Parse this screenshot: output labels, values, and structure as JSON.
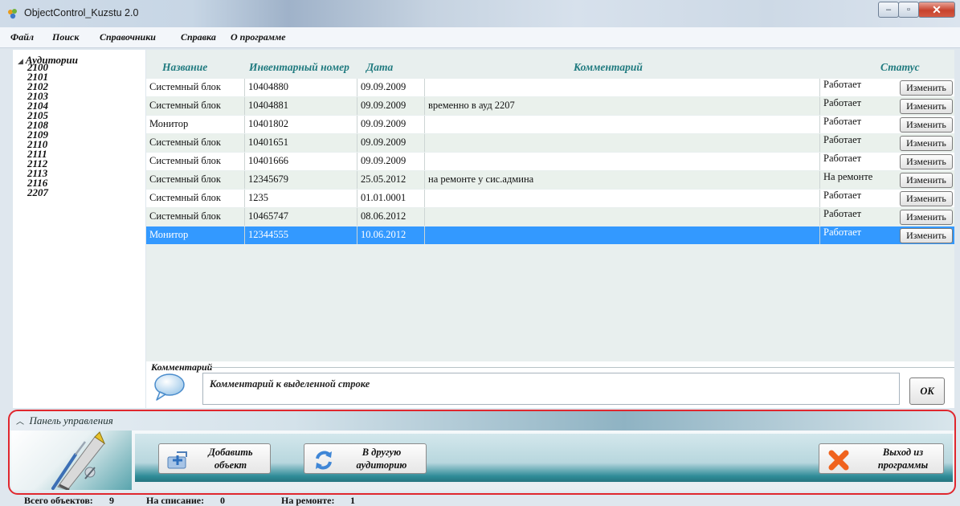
{
  "window": {
    "title": "ObjectControl_Kuzstu 2.0",
    "controls": {
      "minimize": "‒",
      "maximize": "▫",
      "close": "✕"
    }
  },
  "menu": [
    "Файл",
    "Поиск",
    "Справочники",
    "Справка",
    "О программе"
  ],
  "tree": {
    "root": "Аудитории",
    "nodes": [
      "2100",
      "2101",
      "2102",
      "2103",
      "2104",
      "2105",
      "2108",
      "2109",
      "2110",
      "2111",
      "2112",
      "2113",
      "2116",
      "2207"
    ]
  },
  "grid": {
    "columns": [
      "Название",
      "Инвентарный номер",
      "Дата",
      "Комментарий",
      "Статус"
    ],
    "change_label": "Изменить",
    "rows": [
      {
        "name": "Системный блок",
        "inv": "10404880",
        "date": "09.09.2009",
        "comment": "",
        "status": "Работает"
      },
      {
        "name": "Системный блок",
        "inv": "10404881",
        "date": "09.09.2009",
        "comment": "временно в ауд 2207",
        "status": "Работает"
      },
      {
        "name": "Монитор",
        "inv": "10401802",
        "date": "09.09.2009",
        "comment": "",
        "status": "Работает"
      },
      {
        "name": "Системный блок",
        "inv": "10401651",
        "date": "09.09.2009",
        "comment": "",
        "status": "Работает"
      },
      {
        "name": "Системный блок",
        "inv": "10401666",
        "date": "09.09.2009",
        "comment": "",
        "status": "Работает"
      },
      {
        "name": "Системный блок",
        "inv": "12345679",
        "date": "25.05.2012",
        "comment": "на ремонте у сис.админа",
        "status": "На ремонте"
      },
      {
        "name": "Системный блок",
        "inv": "1235",
        "date": "01.01.0001",
        "comment": "",
        "status": "Работает"
      },
      {
        "name": "Системный блок",
        "inv": "10465747",
        "date": "08.06.2012",
        "comment": "",
        "status": "Работает"
      },
      {
        "name": "Монитор",
        "inv": "12344555",
        "date": "10.06.2012",
        "comment": "",
        "status": "Работает",
        "selected": true
      }
    ]
  },
  "comment": {
    "label": "Комментарий",
    "text": "Комментарий к выделенной строке",
    "ok": "OK"
  },
  "panel": {
    "title": "Панель управления",
    "add_line1": "Добавить",
    "add_line2": "объект",
    "move_line1": "В другую",
    "move_line2": "аудиторию",
    "exit_line1": "Выход из",
    "exit_line2": "программы"
  },
  "status": {
    "total_label": "Всего объектов:",
    "total_value": "9",
    "writeoff_label": "На списание:",
    "writeoff_value": "0",
    "repair_label": "На ремонте:",
    "repair_value": "1"
  },
  "colors": {
    "selection": "#3399ff",
    "header_text": "#1f7a7f",
    "highlight_border": "#e0272e"
  }
}
